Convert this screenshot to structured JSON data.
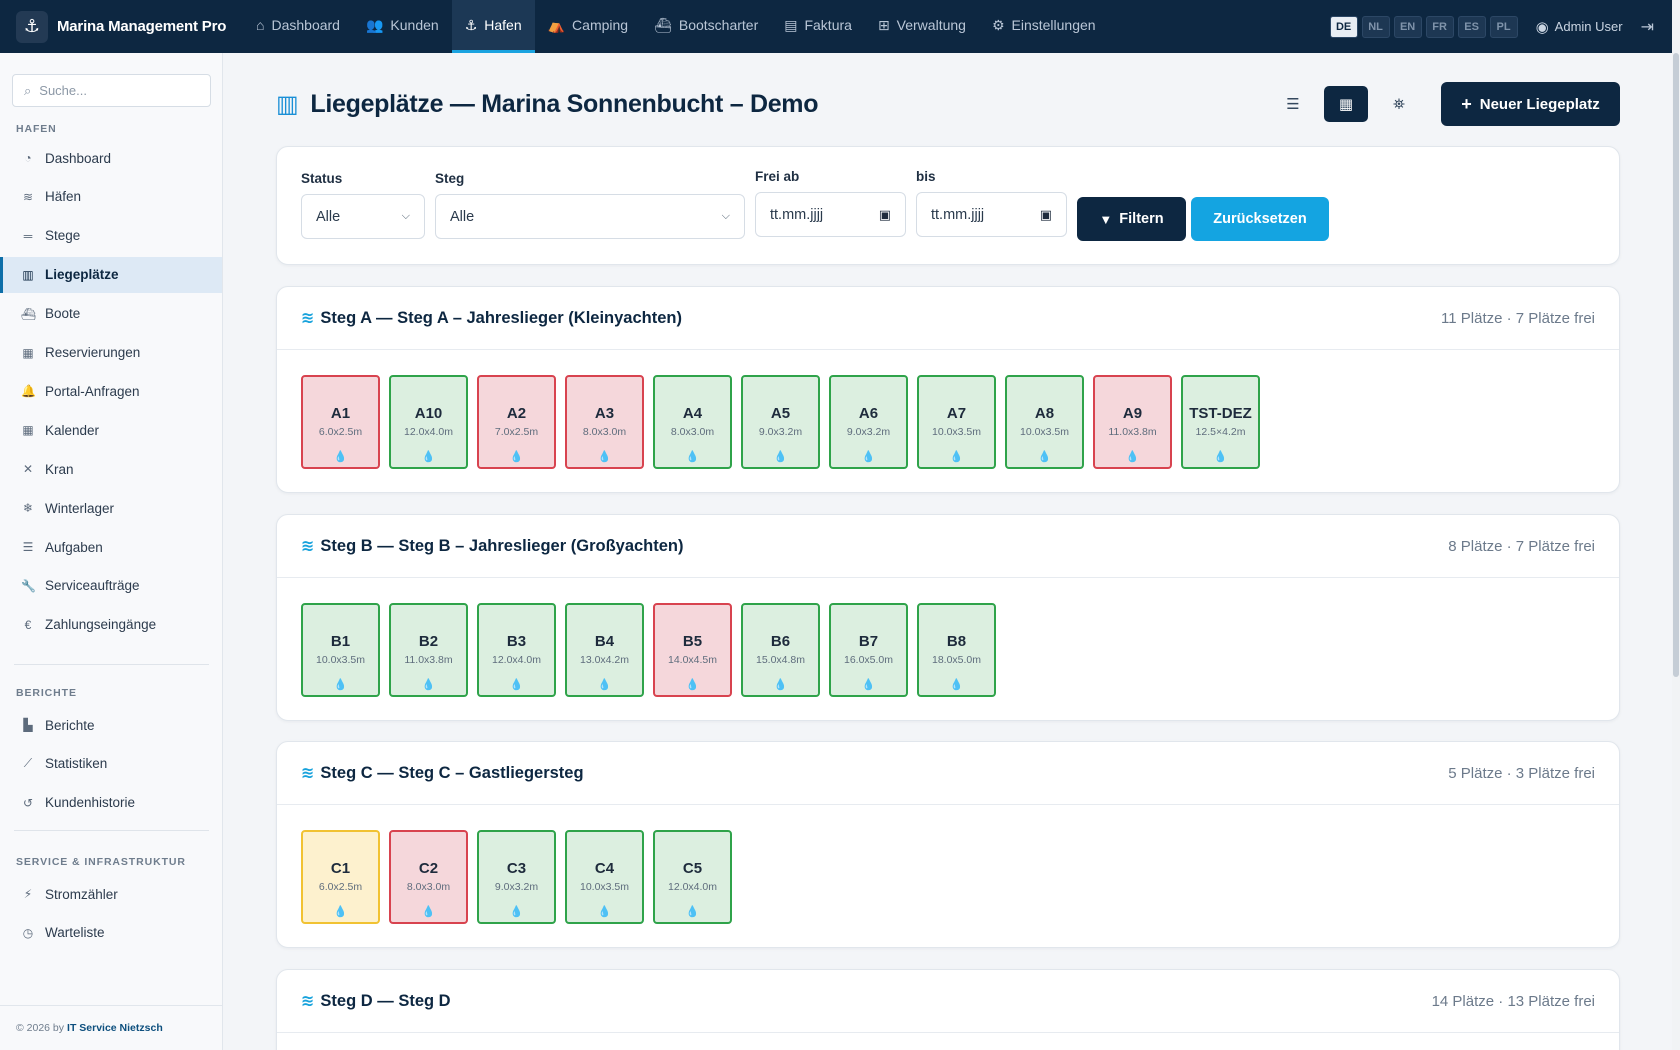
{
  "app": {
    "name": "Marina Management Pro",
    "logo_icon": "anchor-icon"
  },
  "nav": {
    "items": [
      {
        "label": "Dashboard",
        "icon": "home-icon"
      },
      {
        "label": "Kunden",
        "icon": "users-icon"
      },
      {
        "label": "Hafen",
        "icon": "anchor-icon",
        "active": true
      },
      {
        "label": "Camping",
        "icon": "tent-icon"
      },
      {
        "label": "Bootscharter",
        "icon": "ship-icon"
      },
      {
        "label": "Faktura",
        "icon": "invoice-icon"
      },
      {
        "label": "Verwaltung",
        "icon": "table-icon"
      },
      {
        "label": "Einstellungen",
        "icon": "gear-icon"
      }
    ],
    "languages": [
      "DE",
      "NL",
      "EN",
      "FR",
      "ES",
      "PL"
    ],
    "active_language": "DE",
    "user": "Admin User"
  },
  "sidebar": {
    "search_placeholder": "Suche...",
    "sections": [
      {
        "title": "HAFEN",
        "items": [
          {
            "label": "Dashboard",
            "icon": "gauge-icon"
          },
          {
            "label": "Häfen",
            "icon": "water-icon"
          },
          {
            "label": "Stege",
            "icon": "lines-icon"
          },
          {
            "label": "Liegeplätze",
            "icon": "map-icon",
            "active": true
          },
          {
            "label": "Boote",
            "icon": "ship-icon"
          },
          {
            "label": "Reservierungen",
            "icon": "calendar-check-icon"
          },
          {
            "label": "Portal-Anfragen",
            "icon": "bell-icon"
          },
          {
            "label": "Kalender",
            "icon": "calendar-icon"
          },
          {
            "label": "Kran",
            "icon": "tools-icon"
          },
          {
            "label": "Winterlager",
            "icon": "snowflake-icon"
          },
          {
            "label": "Aufgaben",
            "icon": "list-check-icon"
          },
          {
            "label": "Serviceaufträge",
            "icon": "wrench-icon"
          },
          {
            "label": "Zahlungseingänge",
            "icon": "euro-icon"
          }
        ]
      },
      {
        "title": "BERICHTE",
        "items": [
          {
            "label": "Berichte",
            "icon": "bar-chart-icon"
          },
          {
            "label": "Statistiken",
            "icon": "line-chart-icon"
          },
          {
            "label": "Kundenhistorie",
            "icon": "history-icon"
          }
        ]
      },
      {
        "title": "SERVICE & INFRASTRUKTUR",
        "items": [
          {
            "label": "Stromzähler",
            "icon": "bolt-icon"
          },
          {
            "label": "Warteliste",
            "icon": "clock-icon"
          }
        ]
      }
    ],
    "footer_prefix": "© 2026 by",
    "footer_link": "IT Service Nietzsch"
  },
  "page": {
    "title": "Liegeplätze — Marina Sonnenbucht – Demo",
    "new_button": "Neuer Liegeplatz",
    "view_modes": [
      "list-icon",
      "grid-icon",
      "map-marked-icon"
    ],
    "active_view": "grid-icon"
  },
  "filters": {
    "status_label": "Status",
    "status_value": "Alle",
    "steg_label": "Steg",
    "steg_value": "Alle",
    "frei_ab_label": "Frei ab",
    "frei_ab_placeholder": "tt.mm.jjjj",
    "bis_label": "bis",
    "bis_placeholder": "tt.mm.jjjj",
    "filter_button": "Filtern",
    "reset_button": "Zurücksetzen"
  },
  "stege": [
    {
      "title": "Steg A — Steg A – Jahreslieger (Kleinyachten)",
      "summary": "11 Plätze · 7 Plätze frei",
      "places": [
        {
          "name": "A1",
          "dim": "6.0x2.5m",
          "status": "occupied"
        },
        {
          "name": "A10",
          "dim": "12.0x4.0m",
          "status": "free"
        },
        {
          "name": "A2",
          "dim": "7.0x2.5m",
          "status": "occupied"
        },
        {
          "name": "A3",
          "dim": "8.0x3.0m",
          "status": "occupied"
        },
        {
          "name": "A4",
          "dim": "8.0x3.0m",
          "status": "free"
        },
        {
          "name": "A5",
          "dim": "9.0x3.2m",
          "status": "free"
        },
        {
          "name": "A6",
          "dim": "9.0x3.2m",
          "status": "free"
        },
        {
          "name": "A7",
          "dim": "10.0x3.5m",
          "status": "free"
        },
        {
          "name": "A8",
          "dim": "10.0x3.5m",
          "status": "free"
        },
        {
          "name": "A9",
          "dim": "11.0x3.8m",
          "status": "occupied"
        },
        {
          "name": "TST-DEZ",
          "dim": "12.5×4.2m",
          "status": "free"
        }
      ]
    },
    {
      "title": "Steg B — Steg B – Jahreslieger (Großyachten)",
      "summary": "8 Plätze · 7 Plätze frei",
      "places": [
        {
          "name": "B1",
          "dim": "10.0x3.5m",
          "status": "free"
        },
        {
          "name": "B2",
          "dim": "11.0x3.8m",
          "status": "free"
        },
        {
          "name": "B3",
          "dim": "12.0x4.0m",
          "status": "free"
        },
        {
          "name": "B4",
          "dim": "13.0x4.2m",
          "status": "free"
        },
        {
          "name": "B5",
          "dim": "14.0x4.5m",
          "status": "occupied"
        },
        {
          "name": "B6",
          "dim": "15.0x4.8m",
          "status": "free"
        },
        {
          "name": "B7",
          "dim": "16.0x5.0m",
          "status": "free"
        },
        {
          "name": "B8",
          "dim": "18.0x5.0m",
          "status": "free"
        }
      ]
    },
    {
      "title": "Steg C — Steg C – Gastliegersteg",
      "summary": "5 Plätze · 3 Plätze frei",
      "places": [
        {
          "name": "C1",
          "dim": "6.0x2.5m",
          "status": "reserved"
        },
        {
          "name": "C2",
          "dim": "8.0x3.0m",
          "status": "occupied"
        },
        {
          "name": "C3",
          "dim": "9.0x3.2m",
          "status": "free"
        },
        {
          "name": "C4",
          "dim": "10.0x3.5m",
          "status": "free"
        },
        {
          "name": "C5",
          "dim": "12.0x4.0m",
          "status": "free"
        }
      ]
    },
    {
      "title": "Steg D — Steg D",
      "summary": "14 Plätze · 13 Plätze frei",
      "places": []
    }
  ]
}
